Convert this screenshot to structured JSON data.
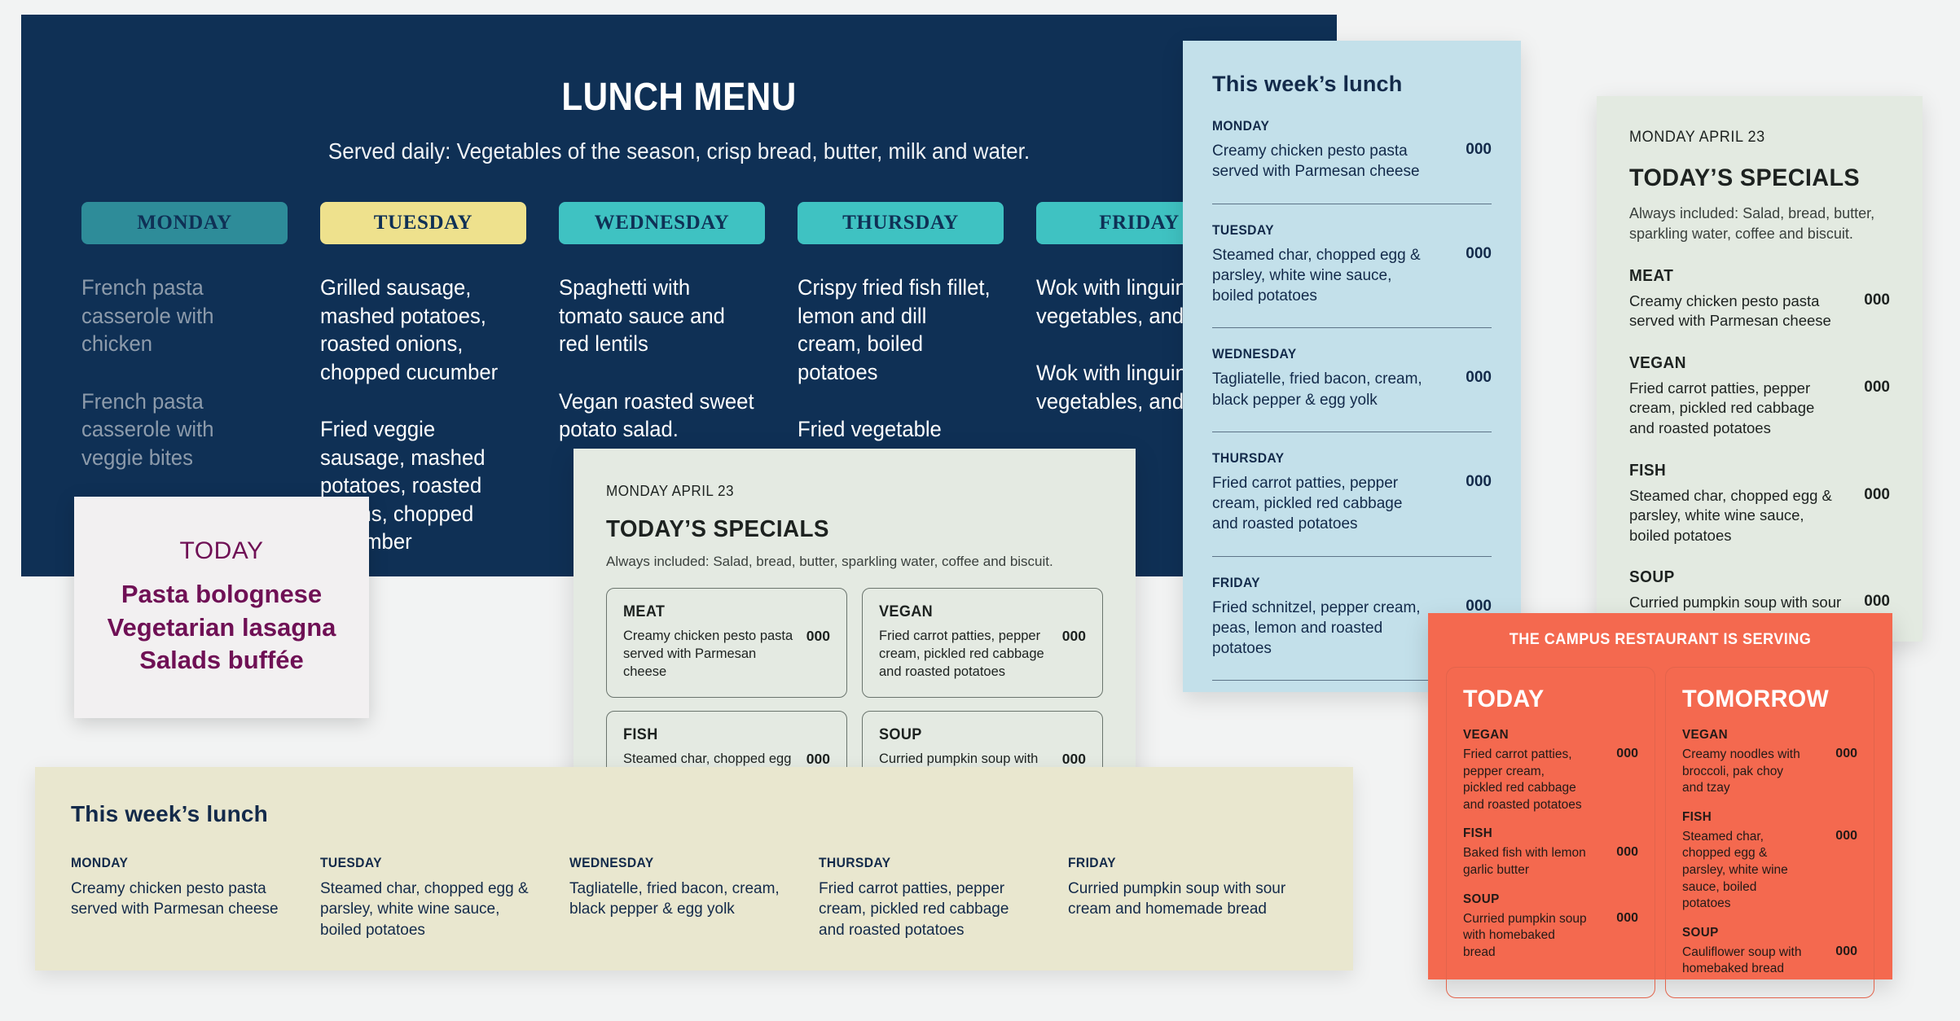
{
  "board": {
    "title": "LUNCH MENU",
    "subtitle": "Served daily: Vegetables of the season, crisp bread, butter, milk and water.",
    "accent_navy": "#0F3055",
    "accent_teal_dark": "#2E8C99",
    "accent_yellow": "#EEE18D",
    "accent_teal": "#3FC2C2",
    "days": [
      {
        "label": "MONDAY",
        "pill_style": "monday",
        "muted": true,
        "dishes": [
          "French pasta casserole with chicken",
          "French pasta casserole with veggie bites"
        ]
      },
      {
        "label": "TUESDAY",
        "pill_style": "tuesday",
        "muted": false,
        "dishes": [
          "Grilled sausage, mashed potatoes, roasted onions, chopped cucumber",
          "Fried veggie sausage, mashed potatoes, roasted onions, chopped cucumber"
        ]
      },
      {
        "label": "WEDNESDAY",
        "pill_style": "teal",
        "muted": false,
        "dishes": [
          "Spaghetti with tomato sauce and red lentils",
          "Vegan roasted sweet potato salad."
        ]
      },
      {
        "label": "THURSDAY",
        "pill_style": "teal",
        "muted": false,
        "dishes": [
          "Crispy fried fish fillet, lemon and dill cream, boiled potatoes",
          "Fried vegetable patty, lemon and dill cream,"
        ]
      },
      {
        "label": "FRIDAY",
        "pill_style": "teal",
        "muted": false,
        "dishes": [
          "Wok with linguini, vegetables, and",
          "Wok with linguini, vegetables, and"
        ]
      }
    ]
  },
  "today_card": {
    "label": "TODAY",
    "accent": "#6F1055",
    "items": [
      "Pasta bolognese",
      "Vegetarian lasagna",
      "Salads buffée"
    ]
  },
  "blue_panel": {
    "title": "This week’s lunch",
    "background": "#C3E0EA",
    "rows": [
      {
        "day": "MONDAY",
        "dish": "Creamy chicken pesto pasta served with Parmesan cheese",
        "price": "000"
      },
      {
        "day": "TUESDAY",
        "dish": "Steamed char, chopped egg & parsley, white wine sauce, boiled potatoes",
        "price": "000"
      },
      {
        "day": "WEDNESDAY",
        "dish": "Tagliatelle, fried bacon, cream, black pepper & egg yolk",
        "price": "000"
      },
      {
        "day": "THURSDAY",
        "dish": "Fried carrot patties, pepper cream, pickled red cabbage and roasted potatoes",
        "price": "000"
      },
      {
        "day": "FRIDAY",
        "dish": "Fried schnitzel, pepper cream, peas, lemon and roasted potatoes",
        "price": "000"
      }
    ]
  },
  "mint_panel": {
    "date": "MONDAY APRIL 23",
    "heading": "TODAY’S SPECIALS",
    "note": "Always included: Salad, bread, butter, sparkling water, coffee and biscuit.",
    "background": "#E3EAE1",
    "items": [
      {
        "category": "MEAT",
        "dish": "Creamy chicken pesto pasta served with Parmesan cheese",
        "price": "000"
      },
      {
        "category": "VEGAN",
        "dish": "Fried carrot patties, pepper cream, pickled red cabbage and roasted potatoes",
        "price": "000"
      },
      {
        "category": "FISH",
        "dish": "Steamed char, chopped egg & parsley, white wine sauce, boiled potatoes",
        "price": "000"
      },
      {
        "category": "SOUP",
        "dish": "Curried pumpkin soup with sour cream and homemade bread",
        "price": "000"
      }
    ]
  },
  "cream_card": {
    "date": "MONDAY APRIL 23",
    "heading": "TODAY’S SPECIALS",
    "note": "Always included: Salad, bread, butter, sparkling water, coffee and biscuit.",
    "background": "#E4EAE2",
    "boxes": [
      {
        "category": "MEAT",
        "dish": "Creamy chicken pesto pasta served with Parmesan cheese",
        "price": "000"
      },
      {
        "category": "VEGAN",
        "dish": "Fried carrot patties, pepper cream, pickled red cabbage and roasted potatoes",
        "price": "000"
      },
      {
        "category": "FISH",
        "dish": "Steamed char, chopped egg & parsley, white wine sauce, boiled potatoes",
        "price": "000"
      },
      {
        "category": "SOUP",
        "dish": "Curried pumpkin soup with sour cream and homemade bread",
        "price": "000"
      }
    ]
  },
  "beige_panel": {
    "title": "This week’s lunch",
    "background": "#E9E7CF",
    "columns": [
      {
        "day": "MONDAY",
        "dish": "Creamy chicken pesto pasta served with Parmesan cheese"
      },
      {
        "day": "TUESDAY",
        "dish": "Steamed char, chopped egg & parsley, white wine sauce, boiled potatoes"
      },
      {
        "day": "WEDNESDAY",
        "dish": "Tagliatelle, fried bacon, cream, black pepper & egg yolk"
      },
      {
        "day": "THURSDAY",
        "dish": "Fried carrot patties, pepper cream, pickled red cabbage and roasted potatoes"
      },
      {
        "day": "FRIDAY",
        "dish": "Curried pumpkin soup with sour cream and homemade bread"
      }
    ]
  },
  "coral_panel": {
    "title": "THE CAMPUS RESTAURANT IS SERVING",
    "background": "#F4694F",
    "columns": [
      {
        "heading": "TODAY",
        "items": [
          {
            "category": "VEGAN",
            "dish": "Fried carrot patties, pepper cream, pickled red cabbage and roasted potatoes",
            "price": "000"
          },
          {
            "category": "FISH",
            "dish": "Baked fish with lemon garlic butter",
            "price": "000"
          },
          {
            "category": "SOUP",
            "dish": "Curried pumpkin soup with homebaked bread",
            "price": "000"
          }
        ]
      },
      {
        "heading": "TOMORROW",
        "items": [
          {
            "category": "VEGAN",
            "dish": "Creamy noodles with broccoli, pak choy and tzay",
            "price": "000"
          },
          {
            "category": "FISH",
            "dish": "Steamed char, chopped egg & parsley, white wine sauce, boiled potatoes",
            "price": "000"
          },
          {
            "category": "SOUP",
            "dish": "Cauliflower soup with homebaked bread",
            "price": "000"
          }
        ]
      }
    ]
  }
}
